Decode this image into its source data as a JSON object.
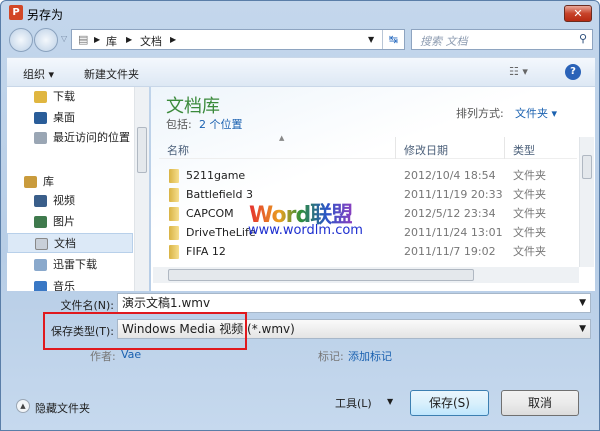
{
  "window": {
    "title": "另存为",
    "app_icon": "P",
    "close": "✕"
  },
  "address": {
    "crumbs": [
      "库",
      "文档"
    ],
    "search_placeholder": "搜索 文档"
  },
  "toolbar": {
    "organize": "组织 ▾",
    "new_folder": "新建文件夹"
  },
  "sidebar": {
    "items": [
      {
        "label": "下载",
        "color": "#e0b640"
      },
      {
        "label": "桌面",
        "color": "#2a5d99"
      },
      {
        "label": "最近访问的位置",
        "color": "#9aa6b4"
      },
      {
        "label": "库",
        "color": "#c99b3c"
      },
      {
        "label": "视频",
        "color": "#3a5e8a"
      },
      {
        "label": "图片",
        "color": "#3f7a4d"
      },
      {
        "label": "文档",
        "color": "#c8cfd8"
      },
      {
        "label": "迅雷下载",
        "color": "#8aa9cc"
      },
      {
        "label": "音乐",
        "color": "#3a78c5"
      }
    ]
  },
  "library": {
    "title": "文档库",
    "includes_label": "包括:",
    "includes_value": "2 个位置",
    "arrange_label": "排列方式:",
    "arrange_value": "文件夹 ▾"
  },
  "columns": {
    "name": "名称",
    "date": "修改日期",
    "type": "类型"
  },
  "files": [
    {
      "name": "5211game",
      "date": "2012/10/4 18:54",
      "type": "文件夹"
    },
    {
      "name": "Battlefield 3",
      "date": "2011/11/19 20:33",
      "type": "文件夹"
    },
    {
      "name": "CAPCOM",
      "date": "2012/5/12 23:34",
      "type": "文件夹"
    },
    {
      "name": "DriveTheLife",
      "date": "2011/11/24 13:01",
      "type": "文件夹"
    },
    {
      "name": "FIFA 12",
      "date": "2011/11/7 19:02",
      "type": "文件夹"
    }
  ],
  "form": {
    "filename_label": "文件名(N):",
    "filename_value": "演示文稿1.wmv",
    "type_label": "保存类型(T):",
    "type_value": "Windows Media 视频 (*.wmv)",
    "author_label": "作者:",
    "author_value": "Vae",
    "tags_label": "标记:",
    "tags_value": "添加标记"
  },
  "buttons": {
    "hide_folders": "隐藏文件夹",
    "tools": "工具(L)",
    "save": "保存(S)",
    "cancel": "取消"
  },
  "watermark": {
    "title": "Word联盟",
    "url": "www.wordlm.com"
  },
  "colors": {
    "highlight": "#e0191e",
    "link": "#1a61b0",
    "library_title": "#3b8a3b"
  }
}
